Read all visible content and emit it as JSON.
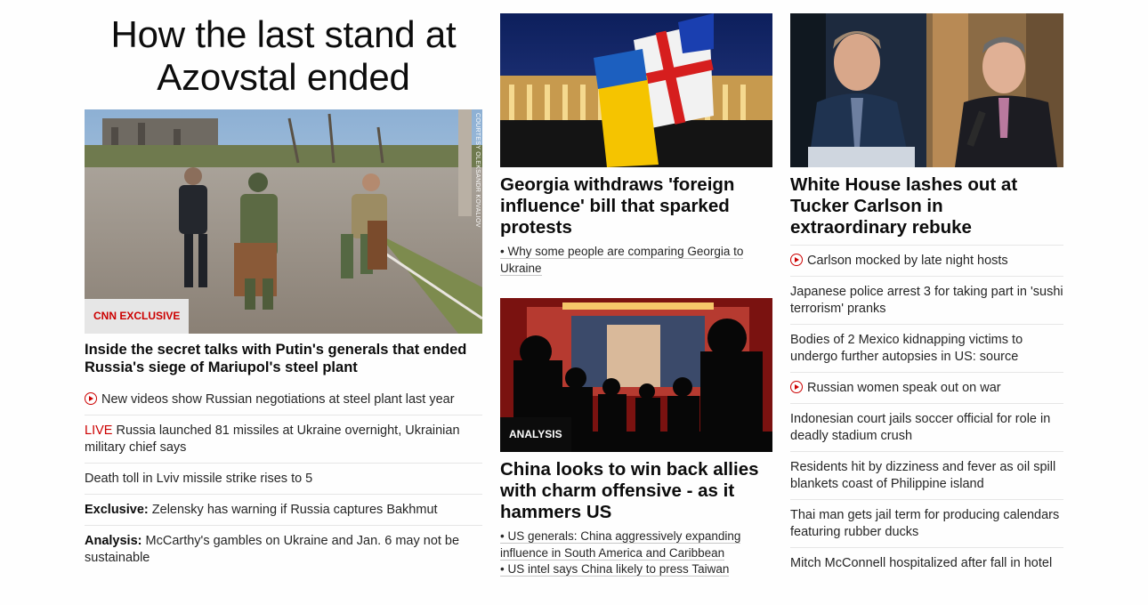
{
  "col1": {
    "hero_title": "How the last stand at Azovstal ended",
    "image_label": "CNN EXCLUSIVE",
    "image_credit": "COURTESY OLEKSANDR KOVALIOV",
    "headline": "Inside the secret talks with Putin's generals that ended Russia's siege of Mariupol's steel plant",
    "links": [
      {
        "prefix": "",
        "text": "New videos show Russian negotiations at steel plant last year",
        "icon": "play-icon"
      },
      {
        "prefix": "LIVE",
        "text": " Russia launched 81 missiles at Ukraine overnight, Ukrainian military chief says"
      },
      {
        "prefix": "",
        "text": "Death toll in Lviv missile strike rises to 5"
      },
      {
        "prefix": "Exclusive:",
        "text": " Zelensky has warning if Russia captures Bakhmut"
      },
      {
        "prefix": "Analysis:",
        "text": " McCarthy's gambles on Ukraine and Jan. 6 may not be sustainable"
      }
    ]
  },
  "col2": {
    "story1": {
      "headline": "Georgia withdraws 'foreign influence' bill that sparked protests",
      "bullets": [
        "• Why some people are comparing Georgia to Ukraine"
      ]
    },
    "story2": {
      "image_label": "ANALYSIS",
      "headline": "China looks to win back allies with charm offensive - as it hammers US",
      "bullets": [
        "• US generals: China aggressively expanding influence in South America and Caribbean",
        "• US intel says China likely to press Taiwan"
      ]
    }
  },
  "col3": {
    "headline": "White House lashes out at Tucker Carlson in extraordinary rebuke",
    "links": [
      {
        "text": "Carlson mocked by late night hosts",
        "icon": "play-icon"
      },
      {
        "text": "Japanese police arrest 3 for taking part in 'sushi terrorism' pranks"
      },
      {
        "text": "Bodies of 2 Mexico kidnapping victims to undergo further autopsies in US: source"
      },
      {
        "text": "Russian women speak out on war",
        "icon": "play-icon"
      },
      {
        "text": "Indonesian court jails soccer official for role in deadly stadium crush"
      },
      {
        "text": "Residents hit by dizziness and fever as oil spill blankets coast of Philippine island"
      },
      {
        "text": "Thai man gets jail term for producing calendars featuring rubber ducks"
      },
      {
        "text": "Mitch McConnell hospitalized after fall in hotel"
      }
    ]
  },
  "colors": {
    "accent_red": "#cc0000",
    "text": "#0c0c0c",
    "divider": "#e6e6e6"
  }
}
